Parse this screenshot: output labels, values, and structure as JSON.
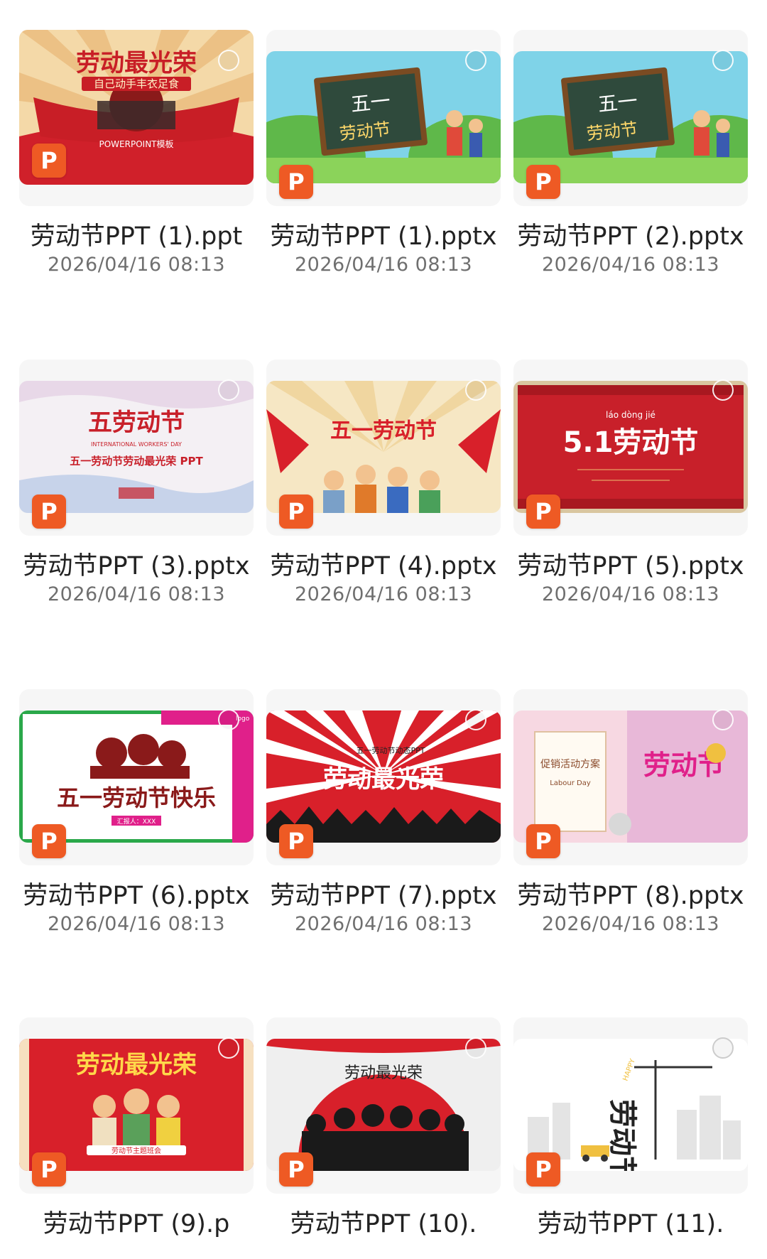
{
  "files": [
    {
      "name": "劳动节PPT (1).ppt",
      "date": "2026/04/16 08:13",
      "badge": "P",
      "thumb_text": "劳动最光荣",
      "thumb_sub": "自己动手丰衣足食",
      "thumb_extra": "POWERPOINT模板"
    },
    {
      "name": "劳动节PPT (1).pptx",
      "date": "2026/04/16 08:13",
      "badge": "P",
      "thumb_text": "五一",
      "thumb_sub": "劳动节"
    },
    {
      "name": "劳动节PPT (2).pptx",
      "date": "2026/04/16 08:13",
      "badge": "P",
      "thumb_text": "五一",
      "thumb_sub": "劳动节"
    },
    {
      "name": "劳动节PPT (3).pptx",
      "date": "2026/04/16 08:13",
      "badge": "P",
      "thumb_text": "五劳动节",
      "thumb_sub": "五一劳动节劳动最光荣 PPT",
      "thumb_extra": "INTERNATIONAL WORKERS' DAY"
    },
    {
      "name": "劳动节PPT (4).pptx",
      "date": "2026/04/16 08:13",
      "badge": "P",
      "thumb_text": "五一劳动节"
    },
    {
      "name": "劳动节PPT (5).pptx",
      "date": "2026/04/16 08:13",
      "badge": "P",
      "thumb_text": "5.1劳动节",
      "thumb_sub": "láo dòng jié"
    },
    {
      "name": "劳动节PPT (6).pptx",
      "date": "2026/04/16 08:13",
      "badge": "P",
      "thumb_text": "五一劳动节快乐",
      "thumb_sub": "汇报人：XXX",
      "thumb_extra": "logo"
    },
    {
      "name": "劳动节PPT (7).pptx",
      "date": "2026/04/16 08:13",
      "badge": "P",
      "thumb_text": "劳动最光荣",
      "thumb_sub": "五一劳动节动态PPT"
    },
    {
      "name": "劳动节PPT (8).pptx",
      "date": "2026/04/16 08:13",
      "badge": "P",
      "thumb_text": "劳动节",
      "thumb_sub": "促销活动方案",
      "thumb_extra": "Labour Day"
    },
    {
      "name": "劳动节PPT (9).p",
      "date": "",
      "badge": "P",
      "thumb_text": "劳动最光荣",
      "thumb_sub": "劳动节主题班会"
    },
    {
      "name": "劳动节PPT (10).",
      "date": "",
      "badge": "P",
      "thumb_text": "劳动最光荣"
    },
    {
      "name": "劳动节PPT (11).",
      "date": "",
      "badge": "P",
      "thumb_text": "劳动节",
      "thumb_sub": "HAPPY"
    }
  ],
  "colors": {
    "badge": "#ee5a24",
    "title_text": "#222222",
    "date_text": "#6f6f6f"
  }
}
